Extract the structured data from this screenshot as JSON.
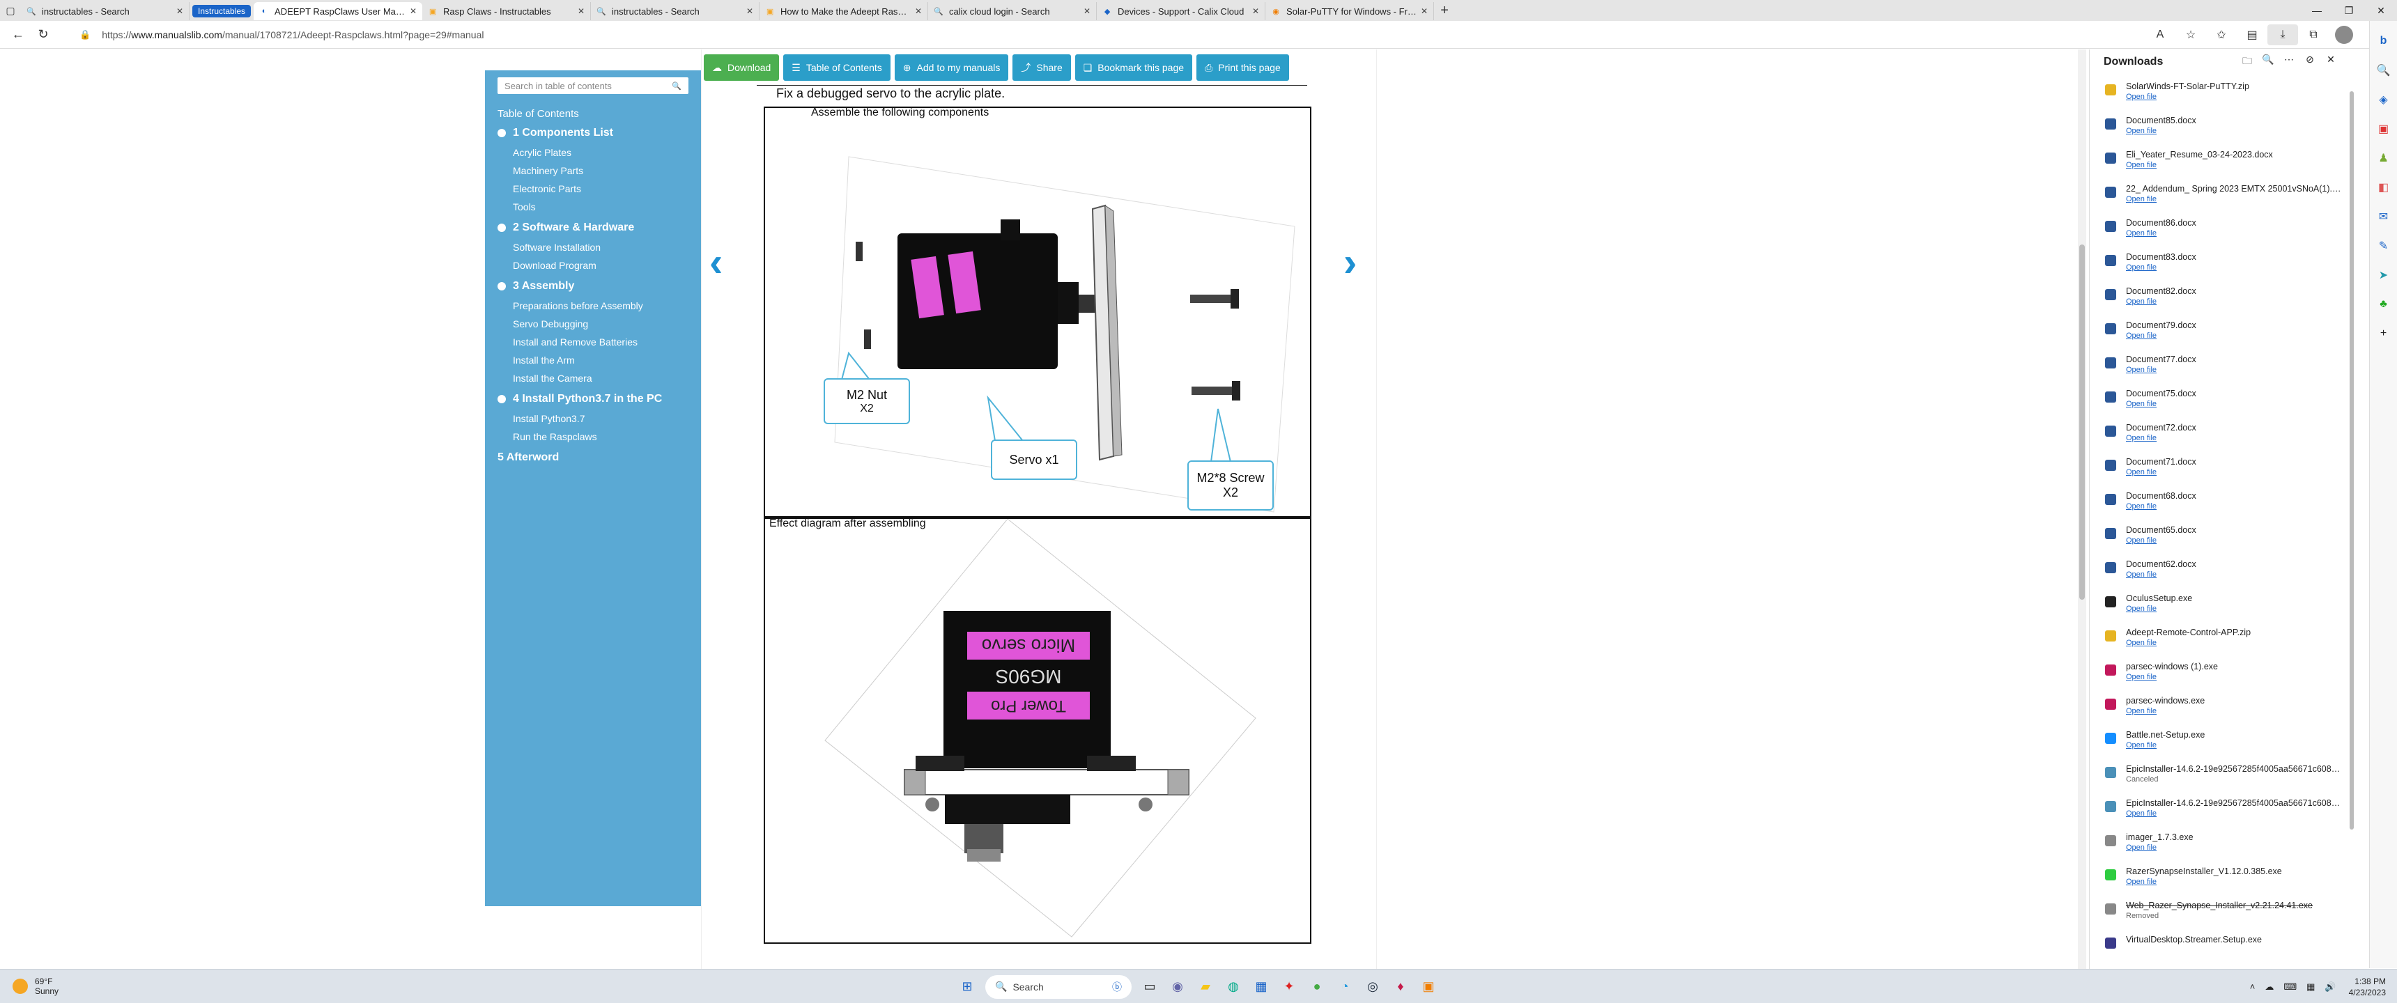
{
  "tabs": [
    {
      "label": "instructables - Search",
      "icon": "search-icon",
      "active": false
    },
    {
      "label": "Instructables",
      "icon": "",
      "active": false,
      "group": true
    },
    {
      "label": "ADEEPT RaspClaws User Manual",
      "icon": "manualslib-icon",
      "active": true
    },
    {
      "label": "Rasp Claws - Instructables",
      "icon": "instructables-icon",
      "active": false
    },
    {
      "label": "instructables - Search",
      "icon": "search-icon",
      "active": false
    },
    {
      "label": "How to Make the Adeept Raspclaws",
      "icon": "instructables-icon",
      "active": false
    },
    {
      "label": "calix cloud login - Search",
      "icon": "search-icon",
      "active": false
    },
    {
      "label": "Devices - Support - Calix Cloud",
      "icon": "calix-icon",
      "active": false
    },
    {
      "label": "Solar-PuTTY for Windows - Free",
      "icon": "solarwinds-icon",
      "active": false
    }
  ],
  "address": {
    "url_prefix": "https://",
    "url_host": "www.manualslib.com",
    "url_path": "/manual/1708721/Adeept-Raspclaws.html?page=29#manual"
  },
  "toolbar_buttons": [
    {
      "label": "Download",
      "icon": "cloud-download-icon"
    },
    {
      "label": "Table of Contents",
      "icon": "list-icon"
    },
    {
      "label": "Add to my manuals",
      "icon": "plus-circle-icon"
    },
    {
      "label": "Share",
      "icon": "share-icon"
    },
    {
      "label": "Bookmark this page",
      "icon": "bookmark-icon"
    },
    {
      "label": "Print this page",
      "icon": "print-icon"
    }
  ],
  "toc": {
    "search_placeholder": "Search in table of contents",
    "heading": "Table of Contents",
    "sections": [
      {
        "title": "1 Components List",
        "items": [
          "Acrylic Plates",
          "Machinery Parts",
          "Electronic Parts",
          "Tools"
        ]
      },
      {
        "title": "2 Software & Hardware",
        "items": [
          "Software Installation",
          "Download Program"
        ]
      },
      {
        "title": "3 Assembly",
        "items": [
          "Preparations before Assembly",
          "Servo Debugging",
          "Install and Remove Batteries",
          "Install the Arm",
          "Install the Camera"
        ]
      },
      {
        "title": "4 Install Python3.7 in the PC",
        "items": [
          "Install Python3.7",
          "Run the Raspclaws"
        ]
      }
    ],
    "afterword": "5 Afterword"
  },
  "document": {
    "heading": "Fix a debugged servo to the acrylic plate.",
    "frame1_caption": "Assemble the following components",
    "frame2_caption": "Effect diagram after assembling",
    "callouts": {
      "nut": {
        "line1": "M2 Nut",
        "line2": "X2"
      },
      "servo": {
        "line1": "Servo x1"
      },
      "screw": {
        "line1": "M2*8 Screw",
        "line2": "X2"
      }
    },
    "servo_labels": {
      "micro": "Micro servo",
      "model": "MG90S",
      "brand": "Tower Pro"
    }
  },
  "downloads": {
    "title": "Downloads",
    "items": [
      {
        "name": "SolarWinds-FT-Solar-PuTTY.zip",
        "status": "Open file",
        "icon": "zip-icon",
        "color": "#e6b422"
      },
      {
        "name": "Document85.docx",
        "status": "Open file",
        "icon": "word-icon",
        "color": "#2b5797"
      },
      {
        "name": "Eli_Yeater_Resume_03-24-2023.docx",
        "status": "Open file",
        "icon": "word-icon",
        "color": "#2b5797"
      },
      {
        "name": "22_ Addendum_ Spring 2023 EMTX 25001vSNoA(1).docx",
        "status": "Open file",
        "icon": "word-icon",
        "color": "#2b5797"
      },
      {
        "name": "Document86.docx",
        "status": "Open file",
        "icon": "word-icon",
        "color": "#2b5797"
      },
      {
        "name": "Document83.docx",
        "status": "Open file",
        "icon": "word-icon",
        "color": "#2b5797"
      },
      {
        "name": "Document82.docx",
        "status": "Open file",
        "icon": "word-icon",
        "color": "#2b5797"
      },
      {
        "name": "Document79.docx",
        "status": "Open file",
        "icon": "word-icon",
        "color": "#2b5797"
      },
      {
        "name": "Document77.docx",
        "status": "Open file",
        "icon": "word-icon",
        "color": "#2b5797"
      },
      {
        "name": "Document75.docx",
        "status": "Open file",
        "icon": "word-icon",
        "color": "#2b5797"
      },
      {
        "name": "Document72.docx",
        "status": "Open file",
        "icon": "word-icon",
        "color": "#2b5797"
      },
      {
        "name": "Document71.docx",
        "status": "Open file",
        "icon": "word-icon",
        "color": "#2b5797"
      },
      {
        "name": "Document68.docx",
        "status": "Open file",
        "icon": "word-icon",
        "color": "#2b5797"
      },
      {
        "name": "Document65.docx",
        "status": "Open file",
        "icon": "word-icon",
        "color": "#2b5797"
      },
      {
        "name": "Document62.docx",
        "status": "Open file",
        "icon": "word-icon",
        "color": "#2b5797"
      },
      {
        "name": "OculusSetup.exe",
        "status": "Open file",
        "icon": "oculus-icon",
        "color": "#222222"
      },
      {
        "name": "Adeept-Remote-Control-APP.zip",
        "status": "Open file",
        "icon": "zip-icon",
        "color": "#e6b422"
      },
      {
        "name": "parsec-windows (1).exe",
        "status": "Open file",
        "icon": "parsec-icon",
        "color": "#c2185b"
      },
      {
        "name": "parsec-windows.exe",
        "status": "Open file",
        "icon": "parsec-icon",
        "color": "#c2185b"
      },
      {
        "name": "Battle.net-Setup.exe",
        "status": "Open file",
        "icon": "battlenet-icon",
        "color": "#148eff"
      },
      {
        "name": "EpicInstaller-14.6.2-19e92567285f4005aa56671c60883e6...",
        "status": "Canceled",
        "icon": "installer-icon",
        "color": "#4a90b8"
      },
      {
        "name": "EpicInstaller-14.6.2-19e92567285f4005aa56671c60883e6...",
        "status": "Open file",
        "icon": "installer-icon",
        "color": "#4a90b8"
      },
      {
        "name": "imager_1.7.3.exe",
        "status": "Open file",
        "icon": "imager-icon",
        "color": "#888888"
      },
      {
        "name": "RazerSynapseInstaller_V1.12.0.385.exe",
        "status": "Open file",
        "icon": "razer-icon",
        "color": "#2ecc40"
      },
      {
        "name": "Web_Razer_Synapse_Installer_v2.21.24.41.exe",
        "status": "Removed",
        "icon": "installer-icon",
        "color": "#888888"
      },
      {
        "name": "VirtualDesktop.Streamer.Setup.exe",
        "status": "",
        "icon": "installer-icon",
        "color": "#3a3a8a"
      }
    ]
  },
  "taskbar": {
    "weather_temp": "69°F",
    "weather_desc": "Sunny",
    "search_label": "Search",
    "time": "1:38 PM",
    "date": "4/23/2023"
  },
  "colors": {
    "accent": "#1a64c8",
    "toc_bg": "#5aa9d4",
    "button_blue": "#2b9ec9",
    "download_green": "#4caf50",
    "callout_border": "#4fb3d9",
    "servo_label": "#e055d8"
  }
}
